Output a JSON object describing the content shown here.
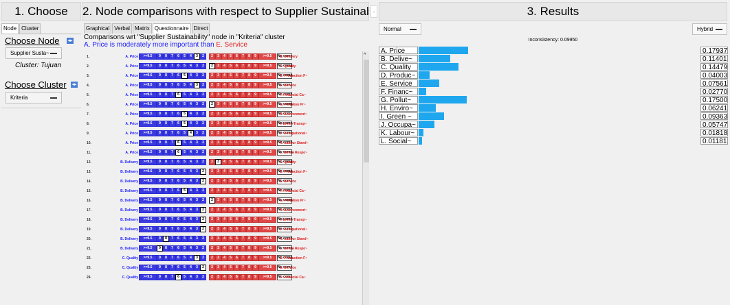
{
  "headers": {
    "choose": "1. Choose",
    "comparisons": "2. Node comparisons with respect to Supplier Sustainabil~",
    "mini": "·",
    "results": "3. Results"
  },
  "left": {
    "tabs": [
      "Node",
      "Cluster"
    ],
    "choose_node": "Choose Node",
    "node_select": "Supplier Susta~",
    "cluster_text": "Cluster: Tujuan",
    "choose_cluster": "Choose Cluster",
    "cluster_select": "Kriteria",
    "arrow": "◂▸"
  },
  "middle": {
    "tabs": [
      "Graphical",
      "Verbal",
      "Matrix",
      "Questionnaire",
      "Direct"
    ],
    "active_tab": "Questionnaire",
    "title": "Comparisons wrt \"Supplier Sustainability\" node in \"Kriteria\" cluster",
    "verbal_left": "A. Price is moderately more important than",
    "verbal_right": "E. Service",
    "scale": [
      ">=9.5",
      "9",
      "8",
      "7",
      "6",
      "5",
      "4",
      "3",
      "2",
      "2",
      "3",
      "4",
      "5",
      "6",
      "7",
      "8",
      "9",
      ">=9.5"
    ],
    "nocomp": "No comp.",
    "rows": [
      {
        "n": "1.",
        "l": "A. Price",
        "r": "B. Delivery",
        "s": 7
      },
      {
        "n": "2.",
        "l": "A. Price",
        "r": "C. Quality",
        "s": 9
      },
      {
        "n": "3.",
        "l": "A. Price",
        "r": "D. Production F~",
        "s": 5
      },
      {
        "n": "4.",
        "l": "A. Price",
        "r": "E. Service",
        "s": 7
      },
      {
        "n": "5.",
        "l": "A. Price",
        "r": "F. Financial Ca~",
        "s": 4
      },
      {
        "n": "6.",
        "l": "A. Price",
        "r": "G. Pollution Pr~",
        "s": 9
      },
      {
        "n": "7.",
        "l": "A. Price",
        "r": "H. Environment~",
        "s": 5
      },
      {
        "n": "8.",
        "l": "A. Price",
        "r": "I. Green Transp~",
        "s": 5
      },
      {
        "n": "9.",
        "l": "A. Price",
        "r": "J. Occupational~",
        "s": 6
      },
      {
        "n": "10.",
        "l": "A. Price",
        "r": "K. Labour Stand~",
        "s": 4
      },
      {
        "n": "11.",
        "l": "A. Price",
        "r": "L. Social Respo~",
        "s": 4
      },
      {
        "n": "12.",
        "l": "B. Delivery",
        "r": "C. Quality",
        "s": 10
      },
      {
        "n": "13.",
        "l": "B. Delivery",
        "r": "D. Production F~",
        "s": 8
      },
      {
        "n": "14.",
        "l": "B. Delivery",
        "r": "E. Service",
        "s": 8
      },
      {
        "n": "15.",
        "l": "B. Delivery",
        "r": "F. Financial Ca~",
        "s": 5
      },
      {
        "n": "16.",
        "l": "B. Delivery",
        "r": "G. Pollution Pr~",
        "s": 9
      },
      {
        "n": "17.",
        "l": "B. Delivery",
        "r": "H. Environment~",
        "s": 8
      },
      {
        "n": "18.",
        "l": "B. Delivery",
        "r": "I. Green Transp~",
        "s": 8
      },
      {
        "n": "19.",
        "l": "B. Delivery",
        "r": "J. Occupational~",
        "s": 8
      },
      {
        "n": "20.",
        "l": "B. Delivery",
        "r": "K. Labour Stand~",
        "s": 2
      },
      {
        "n": "21.",
        "l": "B. Delivery",
        "r": "L. Social Respo~",
        "s": 1
      },
      {
        "n": "22.",
        "l": "C. Quality",
        "r": "D. Production F~",
        "s": 7
      },
      {
        "n": "23.",
        "l": "C. Quality",
        "r": "E. Service",
        "s": 8
      },
      {
        "n": "24.",
        "l": "C. Quality",
        "r": "F. Financial Ca~",
        "s": 4
      }
    ]
  },
  "results": {
    "mode_left": "Normal",
    "mode_right": "Hybrid",
    "inconsistency": "Inconsistency: 0.09950",
    "bar_color": "#1ea7ef",
    "rows": [
      {
        "label": "A. Price",
        "value": "0.17937",
        "frac": 0.17937
      },
      {
        "label": "B. Delive~",
        "value": "0.11401",
        "frac": 0.11401
      },
      {
        "label": "C. Quality",
        "value": "0.14479",
        "frac": 0.14479
      },
      {
        "label": "D. Produc~",
        "value": "0.04003",
        "frac": 0.04003
      },
      {
        "label": "E. Service",
        "value": "0.07561",
        "frac": 0.07561
      },
      {
        "label": "F. Financ~",
        "value": "0.02770",
        "frac": 0.0277
      },
      {
        "label": "G. Pollut~",
        "value": "0.17500",
        "frac": 0.175
      },
      {
        "label": "H. Enviro~",
        "value": "0.06241",
        "frac": 0.06241
      },
      {
        "label": "I. Green ~",
        "value": "0.09363",
        "frac": 0.09363
      },
      {
        "label": "J. Occupa~",
        "value": "0.05747",
        "frac": 0.05747
      },
      {
        "label": "K. Labour~",
        "value": "0.01818",
        "frac": 0.01818
      },
      {
        "label": "L. Social~",
        "value": "0.01181",
        "frac": 0.01181
      }
    ]
  }
}
